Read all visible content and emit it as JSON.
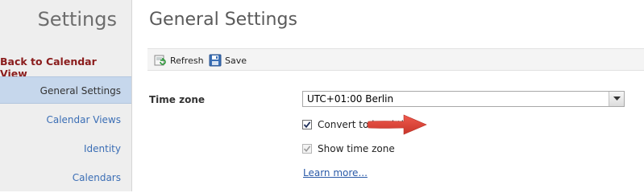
{
  "sidebar": {
    "title": "Settings",
    "back_label": "Back to Calendar View",
    "items": [
      {
        "label": "General Settings",
        "active": true
      },
      {
        "label": "Calendar Views",
        "active": false
      },
      {
        "label": "Identity",
        "active": false
      },
      {
        "label": "Calendars",
        "active": false
      }
    ]
  },
  "main": {
    "title": "General Settings",
    "toolbar": {
      "refresh_label": "Refresh",
      "save_label": "Save"
    },
    "timezone": {
      "label": "Time zone",
      "selected": "UTC+01:00 Berlin"
    },
    "options": {
      "convert_label": "Convert to local time",
      "convert_checked": true,
      "show_tz_label": "Show time zone",
      "show_tz_checked": true,
      "show_tz_disabled": true
    },
    "learn_more": "Learn more..."
  },
  "colors": {
    "accent": "#3b6eb5",
    "back_link": "#8a1c1c",
    "active_item_bg": "#c6d7ec",
    "annotation_arrow": "#e0463a"
  },
  "icons": {
    "refresh": "refresh-icon",
    "save": "save-icon",
    "dropdown": "chevron-down-icon",
    "annotation": "red-arrow-icon"
  }
}
